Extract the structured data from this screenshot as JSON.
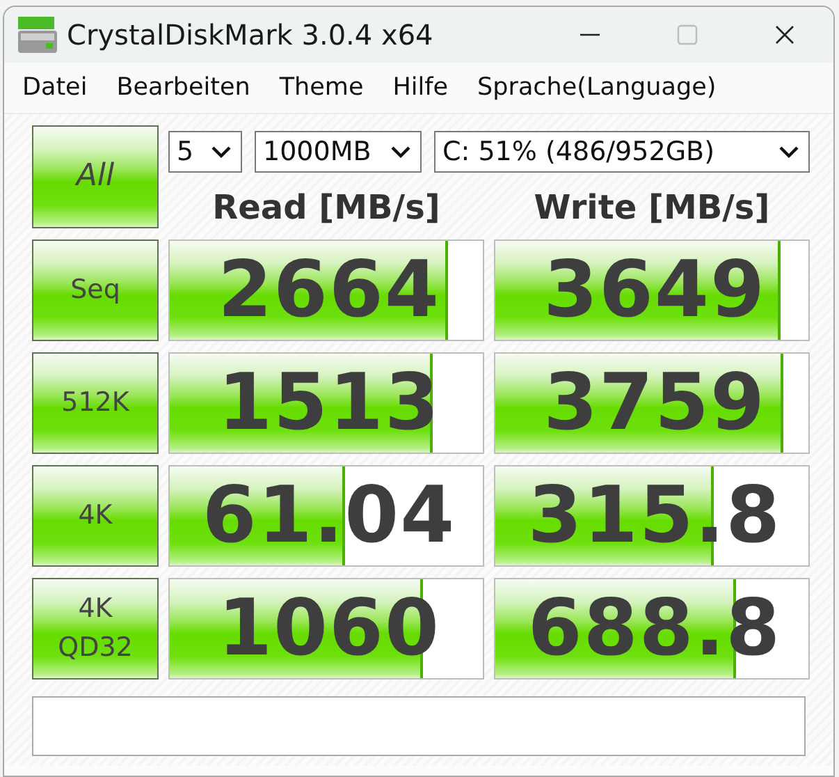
{
  "window": {
    "title": "CrystalDiskMark 3.0.4 x64"
  },
  "menu": [
    "Datei",
    "Bearbeiten",
    "Theme",
    "Hilfe",
    "Sprache(Language)"
  ],
  "all_button": "All",
  "selectors": [
    {
      "kind": "count",
      "value": "5"
    },
    {
      "kind": "size",
      "value": "1000MB"
    },
    {
      "kind": "drive",
      "value": "C: 51% (486/952GB)"
    }
  ],
  "columns": [
    "Read [MB/s]",
    "Write [MB/s]"
  ],
  "rows": [
    {
      "label": "Seq",
      "read": {
        "value": "2664",
        "level": 0.88
      },
      "write": {
        "value": "3649",
        "level": 0.9
      }
    },
    {
      "label": "512K",
      "read": {
        "value": "1513",
        "level": 0.83
      },
      "write": {
        "value": "3759",
        "level": 0.91
      }
    },
    {
      "label": "4K",
      "read": {
        "value": "61.04",
        "level": 0.55
      },
      "write": {
        "value": "315.8",
        "level": 0.69
      }
    },
    {
      "label": "4K\nQD32",
      "read": {
        "value": "1060",
        "level": 0.8
      },
      "write": {
        "value": "688.8",
        "level": 0.76
      }
    }
  ]
}
